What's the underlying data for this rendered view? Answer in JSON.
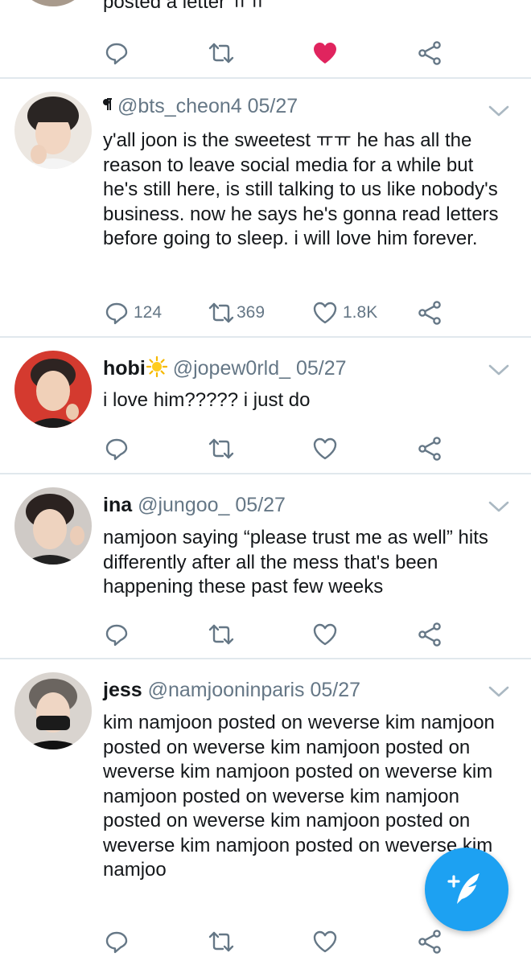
{
  "top_fragment": {
    "text": "posted a letter ㅠㅠ",
    "liked": true
  },
  "tweets": [
    {
      "name": "",
      "handle": "@bts_cheon4",
      "date": "05/27",
      "badge_icon": "pilcrow-icon",
      "text": "y'all joon is the sweetest ㅠㅠ he has all the reason to leave social media for a while but he's still here, is still talking to us like nobody's business. now he says he's gonna read letters before going to sleep. i will love him forever.",
      "replies": "124",
      "retweets": "369",
      "likes": "1.8K"
    },
    {
      "name": "hobi",
      "name_emoji": "sun-emoji-icon",
      "handle": "@jopew0rld_",
      "date": "05/27",
      "text": "i love him????? i just do",
      "replies": "",
      "retweets": "",
      "likes": ""
    },
    {
      "name": "ina",
      "handle": "@jungoo_",
      "date": "05/27",
      "text": "namjoon saying “please trust me as well” hits differently after all the mess that's been happening these past few weeks",
      "replies": "",
      "retweets": "",
      "likes": ""
    },
    {
      "name": "jess",
      "handle": "@namjooninparis",
      "date": "05/27",
      "text": "kim namjoon posted on weverse kim namjoon posted on weverse kim namjoon posted on weverse kim namjoon posted on weverse kim namjoon posted on weverse kim namjoon posted on weverse kim namjoon posted on weverse kim namjoon posted on weverse kim namjoo",
      "replies": "",
      "retweets": "",
      "likes": ""
    }
  ],
  "colors": {
    "accent": "#1da1f2",
    "muted": "#657786",
    "like": "#e0245e",
    "divider": "#e1e8ed"
  }
}
